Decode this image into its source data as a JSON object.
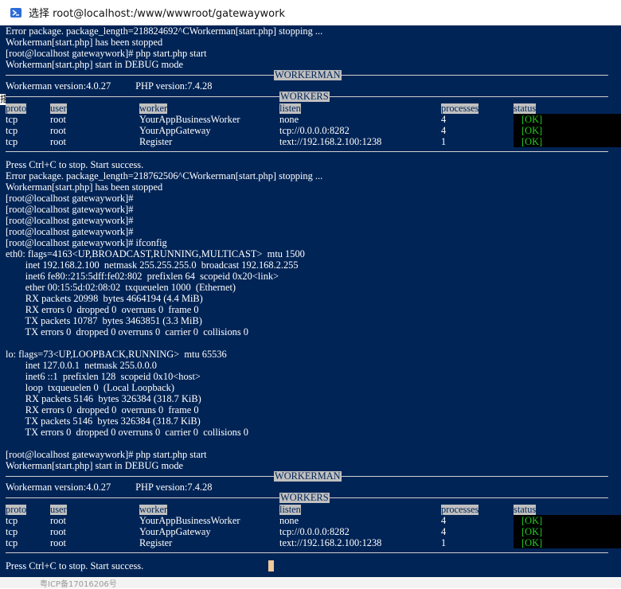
{
  "window": {
    "title": "选择 root@localhost:/www/wwwroot/gatewaywork",
    "icon": "powershell-icon"
  },
  "session1": {
    "lines": [
      "Error package. package_length=218824692^CWorkerman[start.php] stopping ...",
      "Workerman[start.php] has been stopped",
      "[root@localhost gatewaywork]# php start.php start",
      "Workerman[start.php] start in DEBUG mode"
    ],
    "workerman_label": "WORKERMAN",
    "version_line": "Workerman version:4.0.27          PHP version:7.4.28",
    "workers_label": "WORKERS",
    "table": {
      "headers": [
        "proto",
        "user",
        "worker",
        "listen",
        "processes",
        "status"
      ],
      "rows": [
        [
          "tcp",
          "root",
          "YourAppBusinessWorker",
          "none",
          "4",
          "[OK]"
        ],
        [
          "tcp",
          "root",
          "YourAppGateway",
          "tcp://0.0.0.0:8282",
          "4",
          "[OK]"
        ],
        [
          "tcp",
          "root",
          "Register",
          "text://192.168.2.100:1238",
          "1",
          "[OK]"
        ]
      ]
    }
  },
  "middle": {
    "lines": [
      "Press Ctrl+C to stop. Start success.",
      "Error package. package_length=218762506^CWorkerman[start.php] stopping ...",
      "Workerman[start.php] has been stopped",
      "[root@localhost gatewaywork]#",
      "[root@localhost gatewaywork]#",
      "[root@localhost gatewaywork]#",
      "[root@localhost gatewaywork]#",
      "[root@localhost gatewaywork]# ifconfig",
      "eth0: flags=4163<UP,BROADCAST,RUNNING,MULTICAST>  mtu 1500",
      "        inet 192.168.2.100  netmask 255.255.255.0  broadcast 192.168.2.255",
      "        inet6 fe80::215:5dff:fe02:802  prefixlen 64  scopeid 0x20<link>",
      "        ether 00:15:5d:02:08:02  txqueuelen 1000  (Ethernet)",
      "        RX packets 20998  bytes 4664194 (4.4 MiB)",
      "        RX errors 0  dropped 0  overruns 0  frame 0",
      "        TX packets 10787  bytes 3463851 (3.3 MiB)",
      "        TX errors 0  dropped 0 overruns 0  carrier 0  collisions 0",
      "",
      "lo: flags=73<UP,LOOPBACK,RUNNING>  mtu 65536",
      "        inet 127.0.0.1  netmask 255.0.0.0",
      "        inet6 ::1  prefixlen 128  scopeid 0x10<host>",
      "        loop  txqueuelen 0  (Local Loopback)",
      "        RX packets 5146  bytes 326384 (318.7 KiB)",
      "        RX errors 0  dropped 0  overruns 0  frame 0",
      "        TX packets 5146  bytes 326384 (318.7 KiB)",
      "        TX errors 0  dropped 0 overruns 0  carrier 0  collisions 0",
      "",
      "[root@localhost gatewaywork]# php start.php start",
      "Workerman[start.php] start in DEBUG mode"
    ]
  },
  "session2": {
    "workerman_label": "WORKERMAN",
    "version_line": "Workerman version:4.0.27          PHP version:7.4.28",
    "workers_label": "WORKERS",
    "table": {
      "headers": [
        "proto",
        "user",
        "worker",
        "listen",
        "processes",
        "status"
      ],
      "rows": [
        [
          "tcp",
          "root",
          "YourAppBusinessWorker",
          "none",
          "4",
          "[OK]"
        ],
        [
          "tcp",
          "root",
          "YourAppGateway",
          "tcp://0.0.0.0:8282",
          "4",
          "[OK]"
        ],
        [
          "tcp",
          "root",
          "Register",
          "text://192.168.2.100:1238",
          "1",
          "[OK]"
        ]
      ]
    },
    "final_line": "Press Ctrl+C to stop. Start success."
  },
  "colors": {
    "terminal_bg": "#012456",
    "terminal_fg": "#ffffff",
    "header_bg": "#c0c0c0",
    "ok_green": "#1fd01f",
    "cursor": "#f0c89a"
  },
  "footer_text": "粤ICP备17016206号"
}
